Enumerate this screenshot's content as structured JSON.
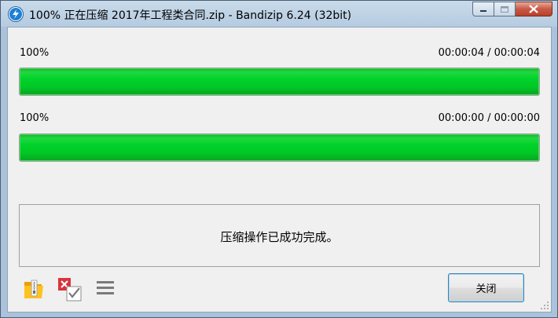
{
  "window": {
    "title": "100% 正在压缩 2017年工程类合同.zip - Bandizip 6.24 (32bit)"
  },
  "progress": [
    {
      "percent_label": "100%",
      "time": "00:00:04 / 00:00:04",
      "fill_fraction": 1.0
    },
    {
      "percent_label": "100%",
      "time": "00:00:00 / 00:00:00",
      "fill_fraction": 1.0
    }
  ],
  "status_message": "压缩操作已成功完成。",
  "toolbar": {
    "icons": [
      "open-folder-icon",
      "delete-archive-icon",
      "menu-icon"
    ]
  },
  "buttons": {
    "close_label": "关闭"
  },
  "colors": {
    "progress_fill": "#00d22a",
    "close_button_border": "#3c7fb1"
  }
}
